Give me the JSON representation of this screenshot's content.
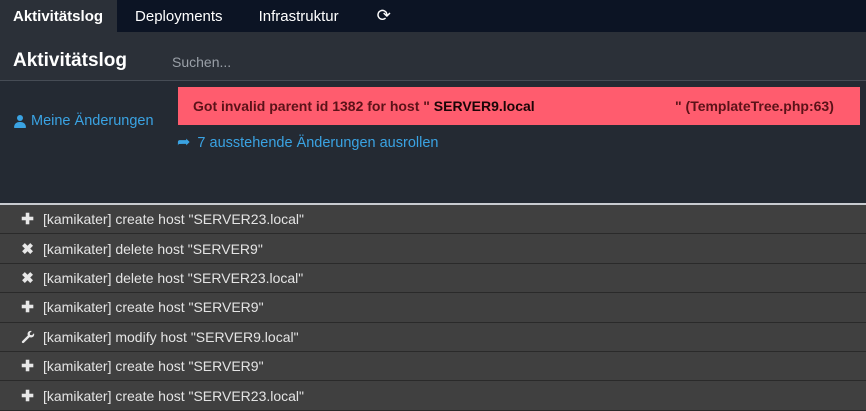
{
  "tabs": [
    {
      "label": "Aktivitätslog",
      "active": true
    },
    {
      "label": "Deployments",
      "active": false
    },
    {
      "label": "Infrastruktur",
      "active": false
    }
  ],
  "refresh_icon": "refresh-icon",
  "header": {
    "title": "Aktivitätslog",
    "search_placeholder": "Suchen...",
    "search_value": ""
  },
  "sidebar": {
    "my_changes": "Meine Änderungen",
    "my_changes_icon": "user-icon"
  },
  "error": {
    "prefix": "Got invalid parent id 1382 for host \" ",
    "host": "SERVER9.local",
    "suffix": "\" (TemplateTree.php:63)",
    "color": "#ff5c6e"
  },
  "rollout": {
    "label": "7 ausstehende Änderungen ausrollen",
    "icon": "share-icon"
  },
  "activity": [
    {
      "icon": "plus-icon",
      "text": "[kamikater] create host \"SERVER23.local\""
    },
    {
      "icon": "cross-icon",
      "text": "[kamikater] delete host \"SERVER9\""
    },
    {
      "icon": "cross-icon",
      "text": "[kamikater] delete host \"SERVER23.local\""
    },
    {
      "icon": "plus-icon",
      "text": "[kamikater] create host \"SERVER9\""
    },
    {
      "icon": "wrench-icon",
      "text": "[kamikater] modify host \"SERVER9.local\""
    },
    {
      "icon": "plus-icon",
      "text": "[kamikater] create host \"SERVER9\""
    },
    {
      "icon": "plus-icon",
      "text": "[kamikater] create host \"SERVER23.local\""
    }
  ]
}
